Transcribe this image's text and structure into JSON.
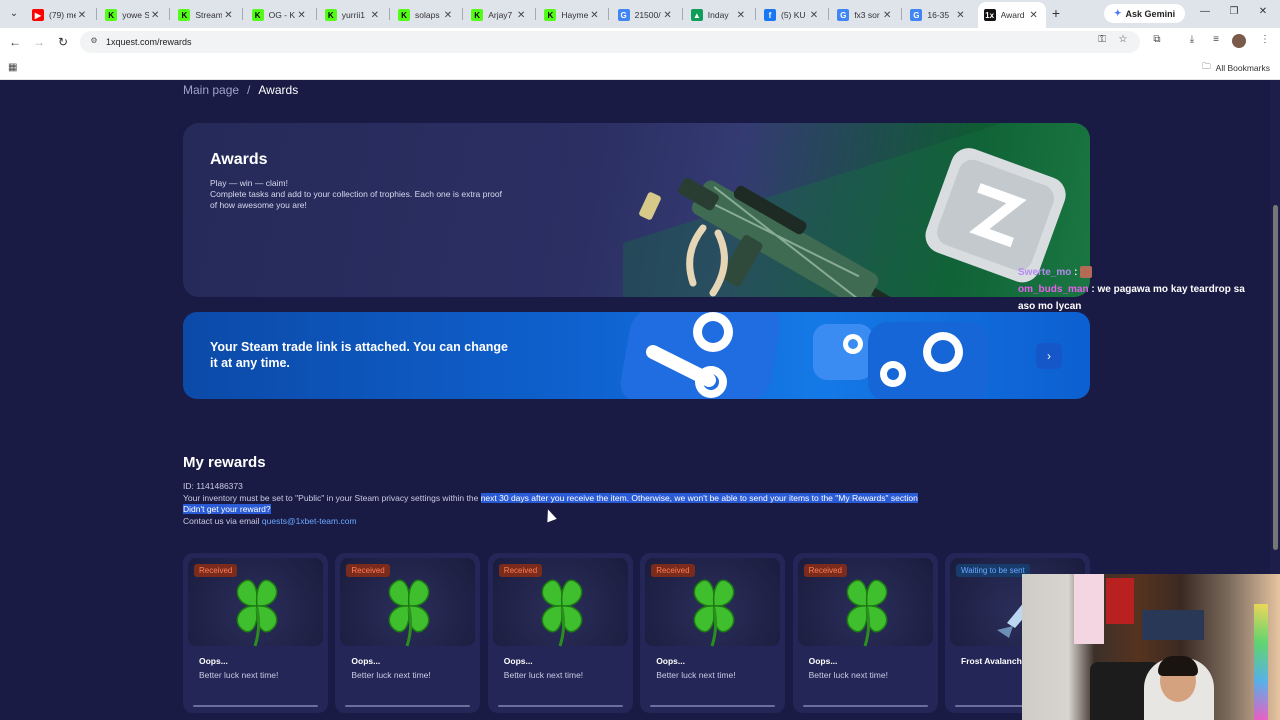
{
  "browser": {
    "tabs": [
      {
        "title": "(79) me",
        "fav_color": "#ff0000",
        "fav_text": "▶"
      },
      {
        "title": "yowe S",
        "fav_color": "#53fc18",
        "fav_text": "K"
      },
      {
        "title": "Stream",
        "fav_color": "#53fc18",
        "fav_text": "K"
      },
      {
        "title": "OG - K",
        "fav_color": "#53fc18",
        "fav_text": "K"
      },
      {
        "title": "yurrii1",
        "fav_color": "#53fc18",
        "fav_text": "K"
      },
      {
        "title": "solaps",
        "fav_color": "#53fc18",
        "fav_text": "K"
      },
      {
        "title": "Arjay7",
        "fav_color": "#53fc18",
        "fav_text": "K"
      },
      {
        "title": "Hayme",
        "fav_color": "#53fc18",
        "fav_text": "K"
      },
      {
        "title": "21500/",
        "fav_color": "#4285f4",
        "fav_text": "G"
      },
      {
        "title": "Inday",
        "fav_color": "#0f9d58",
        "fav_text": "▲"
      },
      {
        "title": "(5) KU",
        "fav_color": "#1877f2",
        "fav_text": "f"
      },
      {
        "title": "fx3 sor",
        "fav_color": "#4285f4",
        "fav_text": "G"
      },
      {
        "title": "16-35",
        "fav_color": "#4285f4",
        "fav_text": "G"
      },
      {
        "title": "Award",
        "fav_color": "#111111",
        "fav_text": "1x"
      }
    ],
    "active_tab": 13,
    "ask_gemini": "Ask Gemini",
    "url": "1xquest.com/rewards",
    "all_bookmarks": "All Bookmarks"
  },
  "breadcrumb": {
    "home": "Main page",
    "sep": "/",
    "current": "Awards"
  },
  "hero": {
    "title": "Awards",
    "description": "Play — win — claim!\nComplete tasks and add to your collection of trophies. Each one is extra proof\nof how awesome you are!"
  },
  "steam": {
    "text": "Your Steam trade link is attached. You can change it at any time."
  },
  "rewards": {
    "title": "My rewards",
    "id_line": "ID: 1141486373",
    "inventory_pre": "Your inventory must be set to \"Public\" in your Steam privacy settings within the ",
    "inventory_hl": "next 30 days after you receive the item. Otherwise, we won't be able to send your items to the \"My Rewards\" section",
    "didnt_get": "Didn't get your reward?",
    "contact_pre": "Contact us via email ",
    "email": "quests@1xbet-team.com"
  },
  "cards": [
    {
      "status": "Received",
      "title": "Oops...",
      "subtitle": "Better luck next time!"
    },
    {
      "status": "Received",
      "title": "Oops...",
      "subtitle": "Better luck next time!"
    },
    {
      "status": "Received",
      "title": "Oops...",
      "subtitle": "Better luck next time!"
    },
    {
      "status": "Received",
      "title": "Oops...",
      "subtitle": "Better luck next time!"
    },
    {
      "status": "Received",
      "title": "Oops...",
      "subtitle": "Better luck next time!"
    },
    {
      "status": "Waiting to be sent",
      "title": "Frost Avalanch",
      "subtitle": ""
    }
  ],
  "chat": [
    {
      "user": "Swerte_mo",
      "sep": " :",
      "message": ""
    },
    {
      "user": "om_buds_man",
      "sep": " : ",
      "message": "we pagawa mo kay teardrop sa"
    },
    {
      "user": "",
      "sep": "",
      "message": "aso mo lycan"
    }
  ],
  "colors": {
    "page_bg": "#191b44",
    "accent": "#1479e6",
    "received": "#ff7d5a",
    "waiting": "#6aa7ff"
  }
}
